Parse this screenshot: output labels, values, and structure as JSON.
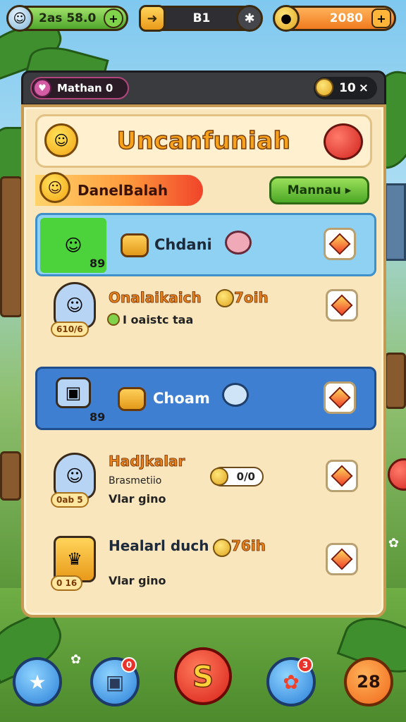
{
  "hud": {
    "gems_value": "2as 58.0",
    "gems_plus": "+",
    "level_value": "B1",
    "coins_value": "2080",
    "coins_plus": "+"
  },
  "panel_header": {
    "player_name": "Mathan 0",
    "coin_count": "10",
    "close_label": "×"
  },
  "title": "Uncanfuniah",
  "sub_banner": "DanelBalah",
  "more_button": "Mannau ▸",
  "rows": [
    {
      "count": "89",
      "name": "Chdani"
    },
    {
      "name": "Onalaikaich",
      "name_suffix": "7oih",
      "sub_count": "610/6",
      "detail": "I oaistc taa"
    },
    {
      "count": "89",
      "name": "Choam"
    },
    {
      "name": "Hadjkalar",
      "tag": "Brasmetiio",
      "detail": "Vlar gino",
      "sub_count": "0ab 5",
      "ratio": "0/0"
    },
    {
      "name": "Healarl duch",
      "name_suffix": "76ih",
      "detail": "Vlar gino",
      "sub_count": "0 16"
    }
  ],
  "bottom_nav": {
    "center_label": "S",
    "right_label": "28",
    "badge_1": "0",
    "badge_2": "3"
  }
}
